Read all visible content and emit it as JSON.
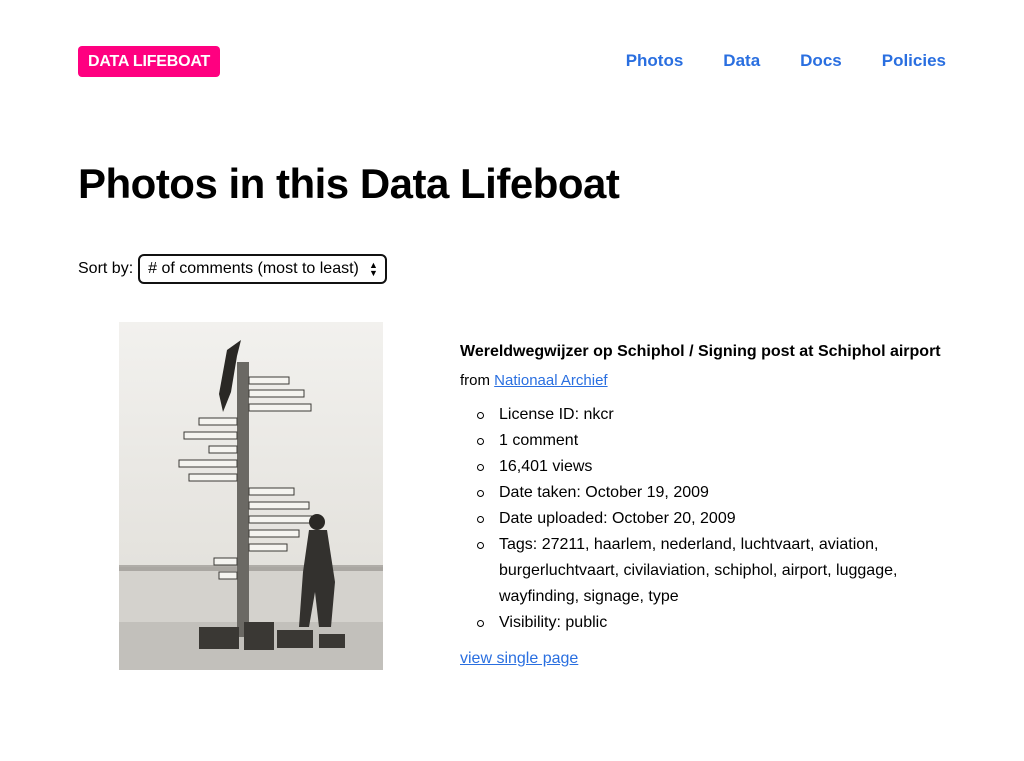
{
  "header": {
    "logo": "DATA LIFEBOAT",
    "nav": [
      "Photos",
      "Data",
      "Docs",
      "Policies"
    ]
  },
  "main": {
    "title": "Photos in this Data Lifeboat",
    "sort": {
      "label": "Sort by:",
      "selected": "# of comments (most to least)"
    },
    "photo": {
      "title": "Wereldwegwijzer op Schiphol / Signing post at Schiphol airport",
      "from_prefix": "from",
      "from_link": "Nationaal Archief",
      "meta": [
        "License ID: nkcr",
        "1 comment",
        "16,401 views",
        "Date taken: October 19, 2009",
        "Date uploaded: October 20, 2009",
        "Tags: 27211, haarlem, nederland, luchtvaart, aviation, burgerluchtvaart, civilaviation, schiphol, airport, luggage, wayfinding, signage, type",
        "Visibility: public"
      ],
      "view_link": "view single page"
    }
  },
  "colors": {
    "brand": "#ff0080",
    "link": "#2a6fe0"
  }
}
